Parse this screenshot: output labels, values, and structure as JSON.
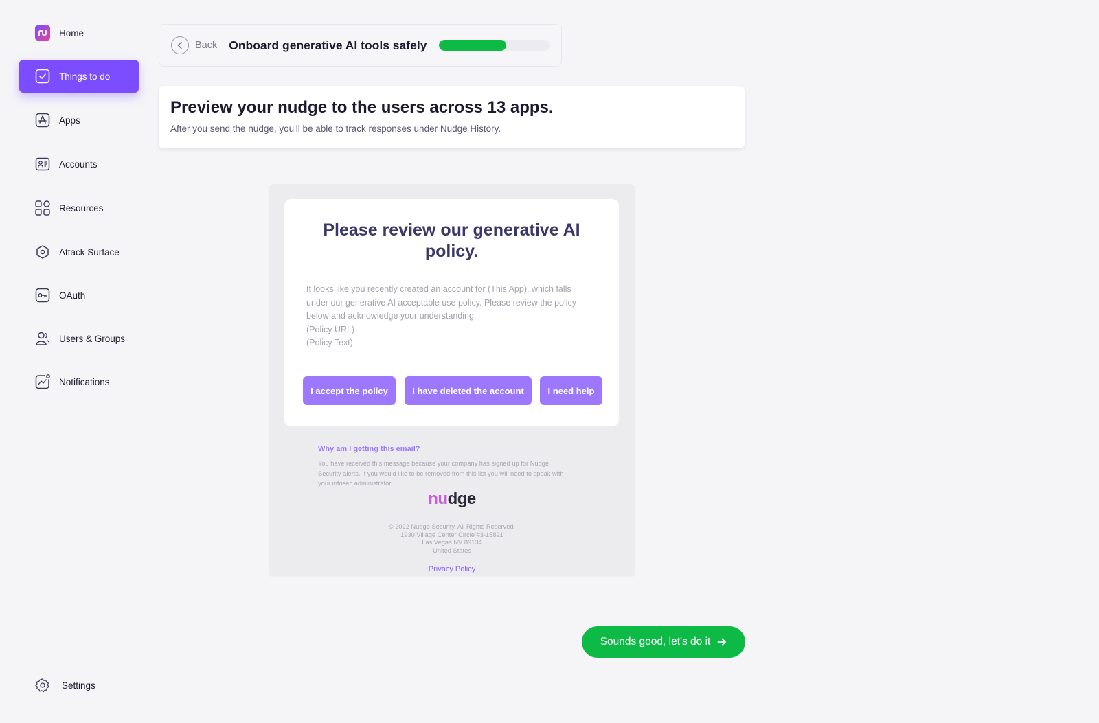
{
  "sidebar": {
    "items": [
      {
        "label": "Home",
        "icon": "nudge-logo-icon"
      },
      {
        "label": "Things to do",
        "icon": "checkbox-icon",
        "active": true
      },
      {
        "label": "Apps",
        "icon": "apps-icon"
      },
      {
        "label": "Accounts",
        "icon": "accounts-icon"
      },
      {
        "label": "Resources",
        "icon": "resources-icon"
      },
      {
        "label": "Attack Surface",
        "icon": "attack-surface-icon"
      },
      {
        "label": "OAuth",
        "icon": "key-icon"
      },
      {
        "label": "Users & Groups",
        "icon": "users-icon"
      },
      {
        "label": "Notifications",
        "icon": "notifications-icon"
      }
    ],
    "settings_label": "Settings"
  },
  "header": {
    "back_label": "Back",
    "title": "Onboard generative AI tools safely",
    "progress": 0.6
  },
  "preview": {
    "title": "Preview your nudge to the users across 13 apps.",
    "subtitle": "After you send the nudge, you'll be able to track responses under Nudge History."
  },
  "email": {
    "heading": "Please review our generative AI policy.",
    "body_lines": [
      "It looks like you recently created an account for (This App), which falls",
      "under our generative AI acceptable use policy. Please review the policy",
      "below and acknowledge your understanding:",
      "(Policy URL)",
      "(Policy Text)"
    ],
    "buttons": {
      "accept": "I accept the policy",
      "deleted": "I have deleted the account",
      "help": "I need help"
    },
    "why_title": "Why am I getting this email?",
    "why_lines": [
      "You have received this message because your company has signed up for Nudge",
      "Security alerts. If you would like to be removed from this list you will need to speak with",
      "your infosec administrator"
    ],
    "logo_prefix": "nu",
    "logo_suffix": "dge",
    "address_lines": [
      "© 2022 Nudge Security. All Rights Reserved.",
      "1930 Village Center Circle #3-15821",
      "Las Vegas NV 89134",
      "United States"
    ],
    "privacy_label": "Privacy Policy"
  },
  "cta": {
    "label": "Sounds good, let's do it"
  },
  "colors": {
    "accent": "#7c4dff",
    "button_purple": "#9d78ff",
    "success": "#0dba45"
  }
}
